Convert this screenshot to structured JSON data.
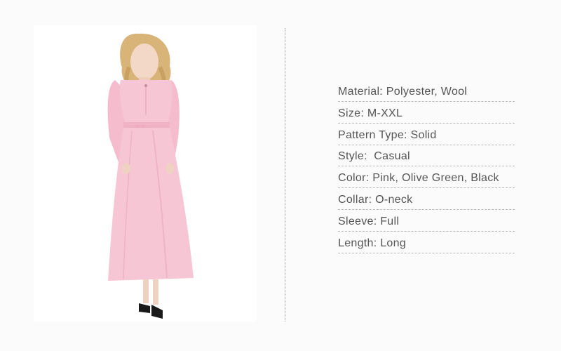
{
  "product": {
    "image_subject": "model-in-long-pink-dress",
    "colors": {
      "dress": "#f7c6d4",
      "dress_shadow": "#eeb3c4",
      "hair": "#d9b479",
      "skin": "#f3d8c8",
      "shoes": "#1a1a1a"
    }
  },
  "specs": [
    {
      "text": "Material: Polyester, Wool"
    },
    {
      "text": "Size: M-XXL"
    },
    {
      "text": "Pattern Type: Solid"
    },
    {
      "text": "Style:  Casual"
    },
    {
      "text": "Color: Pink, Olive Green, Black"
    },
    {
      "text": "Collar: O-neck"
    },
    {
      "text": "Sleeve: Full"
    },
    {
      "text": "Length: Long"
    }
  ]
}
